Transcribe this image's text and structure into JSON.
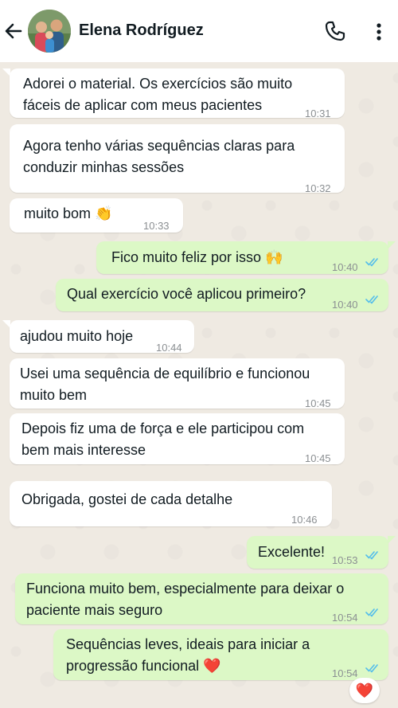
{
  "header": {
    "contact_name": "Elena Rodríguez"
  },
  "messages": [
    {
      "dir": "in",
      "lines": [
        "Adorei o material. Os exercícios são muito",
        "fáceis de aplicar com meus pacientes"
      ],
      "time": "10:31"
    },
    {
      "dir": "in",
      "lines": [
        "Agora tenho várias sequências claras para",
        "conduzir minhas sessões"
      ],
      "time": "10:32"
    },
    {
      "dir": "in",
      "lines": [
        "muito bom 👏"
      ],
      "time": "10:33"
    },
    {
      "dir": "out",
      "lines": [
        "Fico muito feliz por isso 🙌"
      ],
      "time": "10:40",
      "read": true
    },
    {
      "dir": "out",
      "lines": [
        "Qual exercício você aplicou primeiro?"
      ],
      "time": "10:40",
      "read": true
    },
    {
      "dir": "in",
      "lines": [
        "ajudou muito hoje"
      ],
      "time": "10:44"
    },
    {
      "dir": "in",
      "lines": [
        "Usei uma sequência de equilíbrio e funcionou",
        "muito bem"
      ],
      "time": "10:45"
    },
    {
      "dir": "in",
      "lines": [
        "Depois fiz uma de força e ele participou com",
        "bem mais interesse"
      ],
      "time": "10:45"
    },
    {
      "dir": "in",
      "lines": [
        "Obrigada, gostei de cada detalhe"
      ],
      "time": "10:46"
    },
    {
      "dir": "out",
      "lines": [
        "Excelente!"
      ],
      "time": "10:53",
      "read": true
    },
    {
      "dir": "out",
      "lines": [
        "Funciona muito bem, especialmente para deixar o",
        "paciente mais seguro"
      ],
      "time": "10:54",
      "read": true
    },
    {
      "dir": "out",
      "lines": [
        "Sequências leves, ideais para iniciar a",
        "progressão funcional ❤️"
      ],
      "time": "10:54",
      "read": true
    }
  ],
  "reaction": "❤️",
  "colors": {
    "header_bg": "#ffffff",
    "chat_bg": "#efeae2",
    "incoming_bubble": "#ffffff",
    "outgoing_bubble": "#dcf8c6",
    "read_ticks": "#53bdeb"
  },
  "icons": [
    "back-arrow-icon",
    "phone-icon",
    "more-vertical-icon",
    "double-check-icon",
    "heart-icon"
  ]
}
